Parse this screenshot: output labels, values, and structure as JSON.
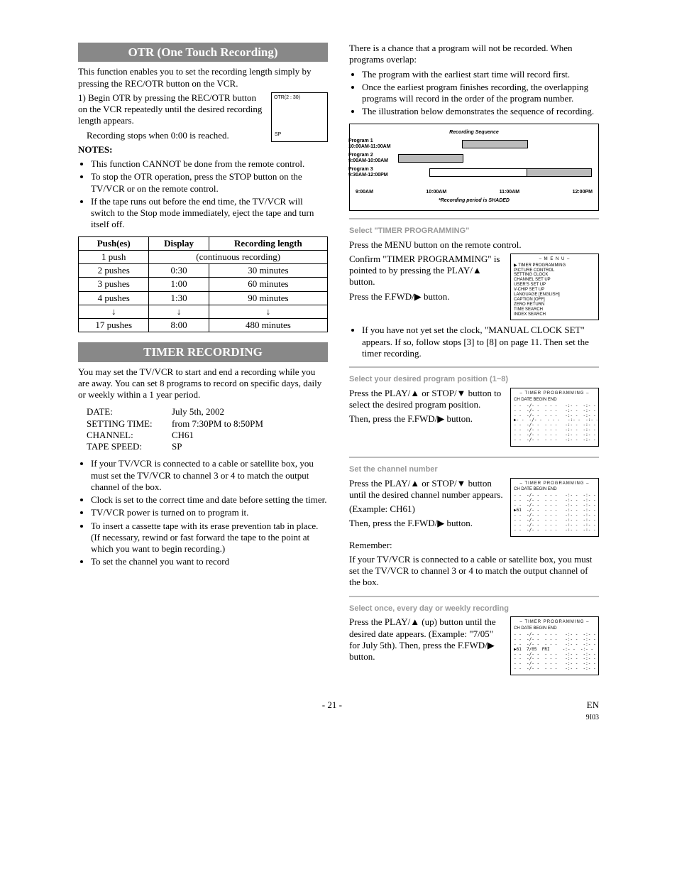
{
  "left": {
    "otr": {
      "heading": "OTR (One Touch Recording)",
      "intro": "This function enables you to set the recording length simply by pressing the REC/OTR button on the VCR.",
      "step1": "1) Begin OTR by pressing the REC/OTR button on the VCR repeatedly until the desired recording length appears.",
      "step1b": "Recording stops when 0:00 is reached.",
      "osd_text": "OTR(2 : 30)",
      "osd_sp": "SP",
      "notes_label": "NOTES:",
      "notes": [
        "This function CANNOT be done from the remote control.",
        "To stop the OTR operation, press the STOP button on the TV/VCR or on the remote control.",
        "If the tape runs out before the end time, the TV/VCR will switch to the Stop mode immediately, eject the tape and turn itself off."
      ],
      "table": {
        "headers": [
          "Push(es)",
          "Display",
          "Recording length"
        ],
        "rows": [
          [
            "1 push",
            "(continuous recording)",
            null
          ],
          [
            "2 pushes",
            "0:30",
            "30 minutes"
          ],
          [
            "3 pushes",
            "1:00",
            "60 minutes"
          ],
          [
            "4 pushes",
            "1:30",
            "90 minutes"
          ],
          [
            "↓",
            "↓",
            "↓"
          ],
          [
            "17 pushes",
            "8:00",
            "480 minutes"
          ]
        ]
      }
    },
    "timer": {
      "heading": "TIMER RECORDING",
      "intro": "You may set the TV/VCR to start and end a recording while you are away. You can set 8 programs to record on specific days, daily or weekly within a 1 year period.",
      "kv": [
        [
          "DATE:",
          "July 5th, 2002"
        ],
        [
          "SETTING TIME:",
          "from 7:30PM to 8:50PM"
        ],
        [
          "CHANNEL:",
          "CH61"
        ],
        [
          "TAPE SPEED:",
          "SP"
        ]
      ],
      "bullets": [
        "If your TV/VCR is connected to a cable or satellite box, you must set the TV/VCR to channel 3 or 4 to match the output channel of the box.",
        "Clock is set to the correct time and date before setting the timer.",
        "TV/VCR power is turned on to program it.",
        "To insert a cassette tape with its erase prevention tab in place. (If necessary, rewind or fast forward the tape to the point at which you want to begin recording.)",
        "To set the channel you want to record"
      ]
    }
  },
  "right": {
    "overlap_intro": "There is a chance that a program will not be recorded. When programs overlap:",
    "overlap_bullets": [
      "The program with the earliest start time will record first.",
      "Once the earliest program finishes recording, the overlapping programs will record in the order of the program number.",
      "The illustration below demonstrates the sequence of recording."
    ],
    "seq": {
      "title": "Recording Sequence",
      "rows": [
        {
          "label1": "Program 1",
          "label2": "10:00AM-11:00AM"
        },
        {
          "label1": "Program 2",
          "label2": "9:00AM-10:00AM"
        },
        {
          "label1": "Program 3",
          "label2": "9:30AM-12:00PM"
        }
      ],
      "times": [
        "9:00AM",
        "10:00AM",
        "11:00AM",
        "12:00PM"
      ],
      "note": "*Recording period is SHADED"
    },
    "step_tp": {
      "heading": "Select \"TIMER PROGRAMMING\"",
      "l1": "Press the MENU button on the remote control.",
      "l2": "Confirm \"TIMER PROGRAMMING\" is pointed to by pressing the PLAY/▲ button.",
      "l3": "Press the F.FWD/▶ button.",
      "l4": "If you have not yet set the clock, \"MANUAL CLOCK SET\" appears. If so, follow stops [3] to [8] on page 11. Then set the timer recording.",
      "menu_title": "– M E N U –",
      "menu_items": [
        "TIMER PROGRAMMING",
        "PICTURE CONTROL",
        "SETTING CLOCK",
        "CHANNEL SET UP",
        "USER'S SET UP",
        "V-CHIP SET UP",
        "LANGUAGE  [ENGLISH]",
        "CAPTION   [OFF]",
        "ZERO RETURN",
        "TIME SEARCH",
        "INDEX SEARCH"
      ]
    },
    "step_pos": {
      "heading": "Select your desired program position (1~8)",
      "l1": "Press the PLAY/▲ or STOP/▼ button to select the desired program position.",
      "l2": "Then, press the F.FWD/▶ button.",
      "osd_title": "– TIMER PROGRAMMING –",
      "osd_hdr": "CH   DATE          BEGIN   END"
    },
    "step_ch": {
      "heading": "Set the channel number",
      "l1": "Press the PLAY/▲ or STOP/▼ button until the desired channel number appears.",
      "l2": "(Example: CH61)",
      "l3": "Then, press the F.FWD/▶ button.",
      "l4": "Remember:",
      "l5": "If your TV/VCR is connected to a cable or satellite box, you must set the TV/VCR to channel 3 or 4 to match the output channel of the box."
    },
    "step_date": {
      "heading": "Select once, every day or weekly recording",
      "l1": "Press the PLAY/▲ (up) button until the desired date appears. (Example: \"7/05\" for July 5th). Then, press the F.FWD/▶ button."
    }
  },
  "footer": {
    "page": "- 21 -",
    "lang": "EN",
    "code": "9I03"
  }
}
